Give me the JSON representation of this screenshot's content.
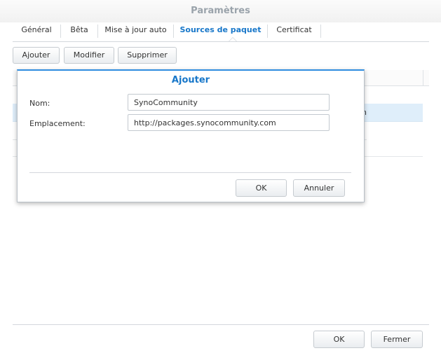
{
  "window": {
    "title": "Paramètres"
  },
  "tabs": [
    {
      "label": "Général",
      "active": false
    },
    {
      "label": "Bêta",
      "active": false
    },
    {
      "label": "Mise à jour auto",
      "active": false
    },
    {
      "label": "Sources de paquet",
      "active": true
    },
    {
      "label": "Certificat",
      "active": false
    }
  ],
  "toolbar": {
    "add_label": "Ajouter",
    "edit_label": "Modifier",
    "delete_label": "Supprimer"
  },
  "list": {
    "selected_row_tail_text": "n"
  },
  "dialog": {
    "title": "Ajouter",
    "name_label": "Nom:",
    "name_value": "SynoCommunity",
    "location_label": "Emplacement:",
    "location_value": "http://packages.synocommunity.com",
    "ok_label": "OK",
    "cancel_label": "Annuler"
  },
  "footer": {
    "ok_label": "OK",
    "close_label": "Fermer"
  },
  "colors": {
    "accent": "#1877c9",
    "dialog_border_top": "#2f8de0",
    "title_gray": "#9aa3ab",
    "selected_row": "#dfeefa"
  }
}
